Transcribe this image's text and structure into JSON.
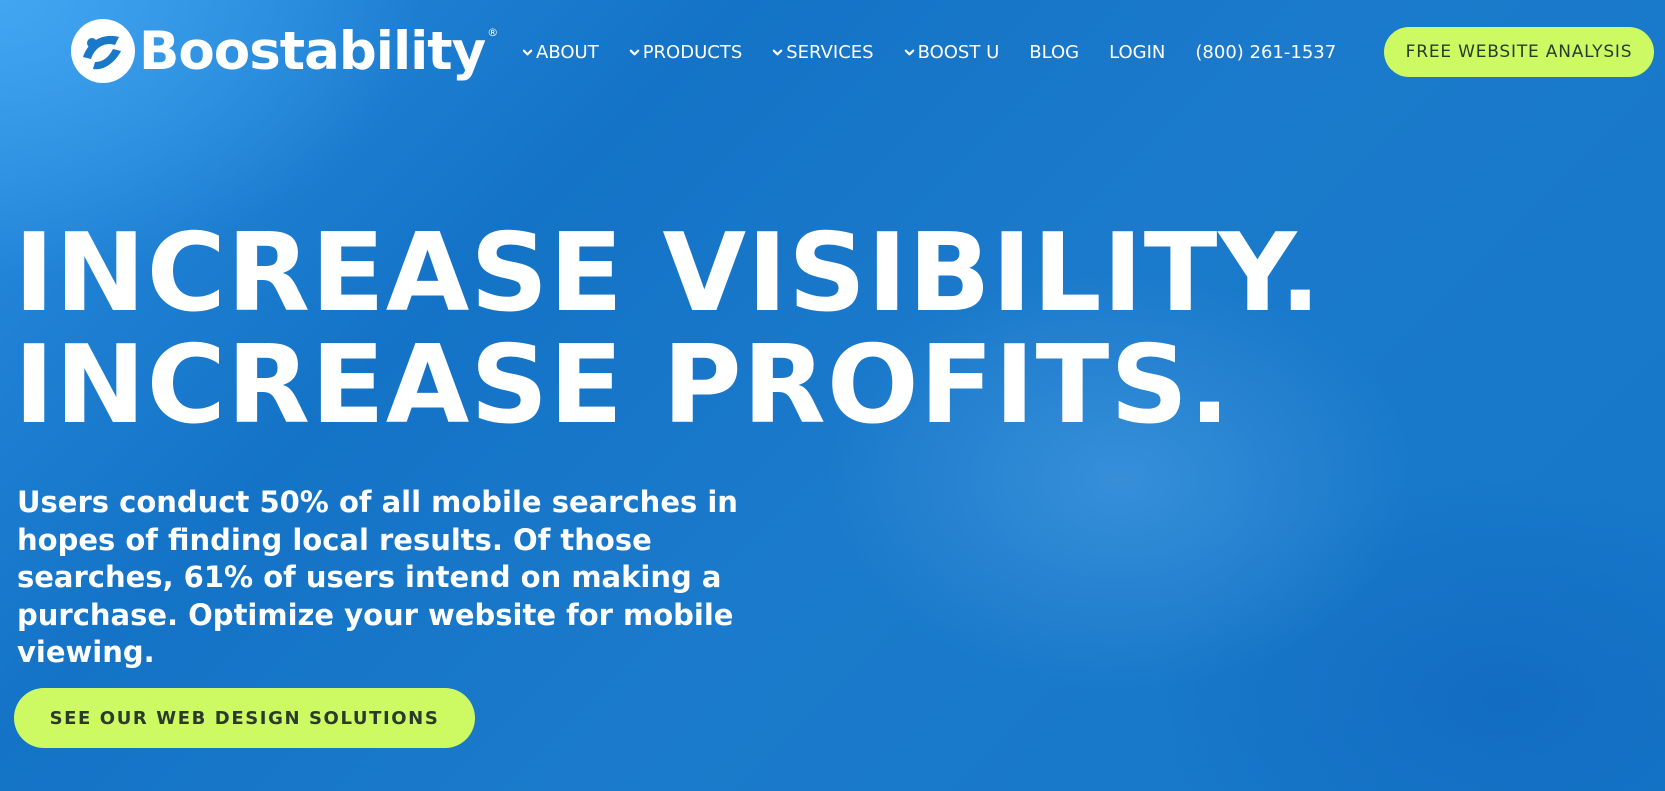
{
  "brand": {
    "name": "Boostability",
    "registered_mark": "®",
    "logo_icon": "boostability-logo-icon"
  },
  "nav": {
    "items": [
      {
        "label": "ABOUT",
        "has_dropdown": true
      },
      {
        "label": "PRODUCTS",
        "has_dropdown": true
      },
      {
        "label": "SERVICES",
        "has_dropdown": true
      },
      {
        "label": "BOOST U",
        "has_dropdown": true
      },
      {
        "label": "BLOG",
        "has_dropdown": false
      },
      {
        "label": "LOGIN",
        "has_dropdown": false
      },
      {
        "label": "(800) 261-1537",
        "has_dropdown": false
      }
    ],
    "dropdown_icon": "chevron-down-icon",
    "cta_label": "FREE WEBSITE ANALYSIS"
  },
  "hero": {
    "headline_line1": "INCREASE VISIBILITY.",
    "headline_line2": "INCREASE PROFITS.",
    "subtext": "Users conduct 50% of all mobile searches in hopes of finding local results. Of those searches, 61% of users intend on making a purchase. Optimize your website for mobile viewing.",
    "cta_label": "SEE OUR WEB DESIGN SOLUTIONS"
  },
  "colors": {
    "background": "#1a78c9",
    "accent": "#cdfa62",
    "accent_text": "#2a3b2c",
    "text": "#ffffff"
  }
}
